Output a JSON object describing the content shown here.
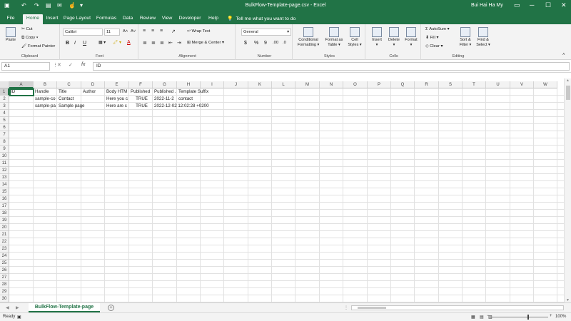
{
  "window": {
    "title": "BulkFlow-Template-page.csv  -  Excel",
    "user": "Bui Hai Ha My",
    "min": "─",
    "max": "☐",
    "close": "✕"
  },
  "quick_access": {
    "save": "💾",
    "undo": "↶",
    "redo": "↷",
    "more": "▾"
  },
  "tabs": [
    "File",
    "Home",
    "Insert",
    "Page Layout",
    "Formulas",
    "Data",
    "Review",
    "View",
    "Developer",
    "Help"
  ],
  "active_tab": "Home",
  "tell_me": "Tell me what you want to do",
  "ribbon": {
    "clipboard": {
      "paste": "Paste",
      "cut": "Cut",
      "copy": "Copy",
      "format_painter": "Format Painter",
      "label": "Clipboard"
    },
    "font": {
      "name": "Calibri",
      "size": "11",
      "grow": "A˄",
      "shrink": "A˅",
      "bold": "B",
      "italic": "I",
      "underline": "U",
      "label": "Font"
    },
    "alignment": {
      "wrap": "Wrap Text",
      "merge": "Merge & Center",
      "label": "Alignment"
    },
    "number": {
      "format": "General",
      "currency": "$",
      "percent": "%",
      "comma": "9",
      "inc_dec": ".00",
      "dec_dec": ".0",
      "label": "Number"
    },
    "styles": {
      "conditional": "Conditional",
      "conditional2": "Formatting",
      "format_table": "Format as",
      "format_table2": "Table",
      "cell_styles": "Cell",
      "cell_styles2": "Styles",
      "label": "Styles"
    },
    "cells": {
      "insert": "Insert",
      "delete": "Delete",
      "format": "Format",
      "label": "Cells"
    },
    "editing": {
      "autosum": "AutoSum",
      "fill": "Fill",
      "clear": "Clear",
      "sort": "Sort &",
      "sort2": "Filter",
      "find": "Find &",
      "find2": "Select",
      "label": "Editing"
    }
  },
  "formula_bar": {
    "name_box": "A1",
    "cancel": "✕",
    "enter": "✓",
    "fx": "fx",
    "content": "ID"
  },
  "columns": [
    "A",
    "B",
    "C",
    "D",
    "E",
    "F",
    "G",
    "H",
    "I",
    "J",
    "K",
    "L",
    "M",
    "N",
    "O",
    "P",
    "Q",
    "R",
    "S",
    "T",
    "U",
    "V",
    "W"
  ],
  "rows": [
    "1",
    "2",
    "3",
    "4",
    "5",
    "6",
    "7",
    "8",
    "9",
    "10",
    "11",
    "12",
    "13",
    "14",
    "15",
    "16",
    "17",
    "18",
    "19",
    "20",
    "21",
    "22",
    "23",
    "24",
    "25",
    "26",
    "27",
    "28",
    "29",
    "30"
  ],
  "cells": {
    "r1": [
      "ID",
      "Handle",
      "Title",
      "Author",
      "Body HTM",
      "Published",
      "Published .",
      "Template Suffix"
    ],
    "r2": [
      "",
      "sample-co",
      "Contact",
      "",
      "Here you c",
      "TRUE",
      "2022-11-2",
      "contact"
    ],
    "r3": [
      "",
      "sample-pa",
      "Sample page",
      "",
      "Here are c",
      "TRUE",
      "2022-12-02 12:02:28 +0200",
      ""
    ]
  },
  "sheet": {
    "name": "BulkFlow-Template-page",
    "add": "+"
  },
  "status": {
    "ready": "Ready",
    "zoom": "100%",
    "zoom_minus": "−",
    "zoom_plus": "+"
  },
  "colors": {
    "accent": "#217346",
    "ribbon_bg": "#f3f3f3"
  }
}
